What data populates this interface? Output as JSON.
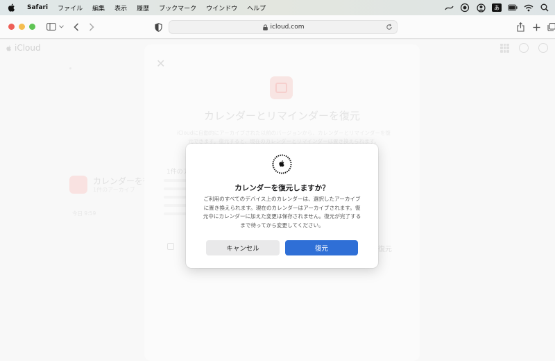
{
  "menubar": {
    "items": [
      "Safari",
      "ファイル",
      "編集",
      "表示",
      "履歴",
      "ブックマーク",
      "ウインドウ",
      "ヘルプ"
    ],
    "input_indicator": "あ"
  },
  "toolbar": {
    "url": "icloud.com"
  },
  "page": {
    "logo_text": "iCloud"
  },
  "background_card": {
    "title": "カレンダーとリマインダーを復元",
    "description": "iCloudに自動的にアーカイブされた以前のバージョンから、カレンダーとリマインダーを復元できます。復元すると、現在のカレンダーとリマインダーは置き換えられます。",
    "section_label": "1件のアーカイブ",
    "restore_link": "復元"
  },
  "left_item": {
    "title": "カレンダーを復元",
    "subtitle": "1件のアーカイブ",
    "date": "今日 9:59"
  },
  "dialog": {
    "title": "カレンダーを復元しますか？",
    "body": "ご利用のすべてのデバイス上のカレンダーは、選択したアーカイブに置き換えられます。現在のカレンダーはアーカイブされます。復元中にカレンダーに加えた変更は保存されません。復元が完了するまで待ってから変更してください。",
    "cancel_label": "キャンセル",
    "restore_label": "復元"
  },
  "colors": {
    "primary_button": "#2f6fd6",
    "cancel_button": "#e9e9ea",
    "traffic_red": "#ee5f57",
    "traffic_yellow": "#f5bd4f",
    "traffic_green": "#5fc454"
  }
}
